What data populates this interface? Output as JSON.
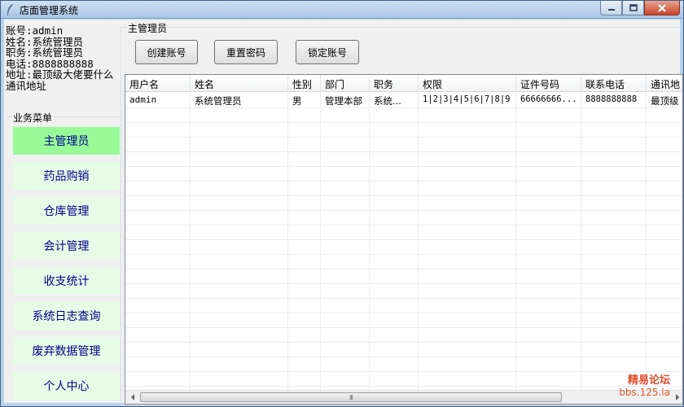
{
  "window": {
    "title": "店面管理系统"
  },
  "user_info": {
    "account": "账号:admin",
    "name": "姓名:系统管理员",
    "position": "职务:系统管理员",
    "phone": "电话:8888888888",
    "address": "地址:最顶级大佬要什么通讯地址"
  },
  "sidebar": {
    "group_label": "业务菜单",
    "items": [
      {
        "label": "主管理员",
        "active": true
      },
      {
        "label": "药品购销"
      },
      {
        "label": "仓库管理"
      },
      {
        "label": "会计管理"
      },
      {
        "label": "收支统计"
      },
      {
        "label": "系统日志查询"
      },
      {
        "label": "废弃数据管理"
      },
      {
        "label": "个人中心"
      }
    ]
  },
  "main": {
    "group_label": "主管理员",
    "buttons": {
      "create": "创建账号",
      "reset": "重置密码",
      "lock": "锁定账号"
    },
    "table": {
      "columns": [
        "用户名",
        "姓名",
        "性别",
        "部门",
        "职务",
        "权限",
        "证件号码",
        "联系电话",
        "通讯地"
      ],
      "rows": [
        [
          "admin",
          "系统管理员",
          "男",
          "管理本部",
          "系统...",
          "1|2|3|4|5|6|7|8|9",
          "66666666...",
          "8888888888",
          "最顶级"
        ]
      ]
    },
    "scrollbar": {
      "grip": "III"
    }
  },
  "watermark": {
    "line1": "精易论坛",
    "line2": "bbs.125.la"
  },
  "colors": {
    "menu_active": "#98fb98",
    "menu_inactive": "#e6fce6",
    "menu_text": "#00008b",
    "watermark": "#e24a2a"
  }
}
